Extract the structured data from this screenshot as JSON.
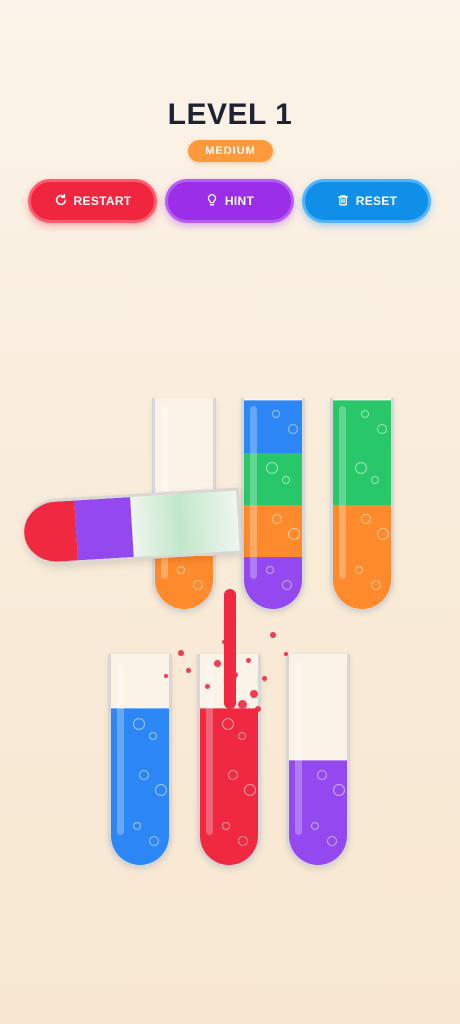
{
  "header": {
    "title": "LEVEL 1",
    "difficulty": "MEDIUM"
  },
  "buttons": {
    "restart": "RESTART",
    "hint": "HINT",
    "reset": "RESET"
  },
  "colors": {
    "red": "#f02840",
    "purple": "#9448f0",
    "blue": "#2d86f5",
    "green": "#27c76a",
    "orange": "#ff8a2b",
    "empty": "#fbf3e8",
    "badge": "#ff9a3c"
  },
  "tubes": [
    {
      "id": "tube-1",
      "capacity": 4,
      "layers_bottom_to_top": [
        "orange"
      ],
      "tilted_out": true
    },
    {
      "id": "tube-2",
      "capacity": 4,
      "layers_bottom_to_top": [
        "purple",
        "orange",
        "green",
        "blue"
      ]
    },
    {
      "id": "tube-3",
      "capacity": 4,
      "layers_bottom_to_top": [
        "orange",
        "orange",
        "green",
        "green"
      ]
    },
    {
      "id": "tube-4",
      "capacity": 4,
      "layers_bottom_to_top": [
        "blue",
        "blue",
        "blue"
      ]
    },
    {
      "id": "tube-5",
      "capacity": 4,
      "layers_bottom_to_top": [
        "red",
        "red",
        "red"
      ],
      "receiving_pour": true
    },
    {
      "id": "tube-6",
      "capacity": 4,
      "layers_bottom_to_top": [
        "purple",
        "purple"
      ]
    }
  ],
  "held_tube": {
    "from": "tube-1",
    "layers_from_mouth": [
      "red",
      "purple",
      "green"
    ],
    "pouring_color": "red"
  }
}
